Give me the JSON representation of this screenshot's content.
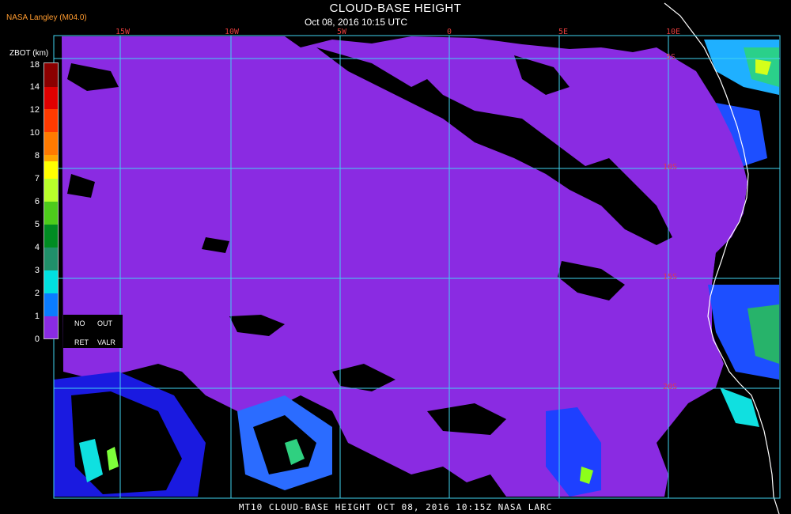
{
  "header": {
    "title": "CLOUD-BASE HEIGHT",
    "subtitle": "Oct 08, 2016 10:15 UTC",
    "producer": "NASA Langley (M04.0)"
  },
  "map": {
    "longitude_labels": [
      "15W",
      "10W",
      "5W",
      "0",
      "5E",
      "10E"
    ],
    "latitude_labels": [
      "5S",
      "10S",
      "15S",
      "20S"
    ],
    "colors": {
      "background_no_retrieval": "#000000",
      "dominant_cloud_base": "#8a2be2",
      "grid": "#41d3f0",
      "coastline": "#ffffff"
    }
  },
  "legend": {
    "title": "ZBOT (km)",
    "ticks": [
      "18",
      "14",
      "12",
      "10",
      "8",
      "7",
      "6",
      "5",
      "4",
      "3",
      "2",
      "1",
      "0"
    ],
    "colors": [
      "#8b0000",
      "#e00000",
      "#ff3a00",
      "#ff7a00",
      "#ffa500",
      "#ffff00",
      "#b8ff2a",
      "#4dcc1b",
      "#008c22",
      "#20906a",
      "#00e0e0",
      "#0a7cff",
      "#0000ff",
      "#8a2be2"
    ],
    "no_ret_label": [
      "NO",
      "RET"
    ],
    "out_valr_label": [
      "OUT",
      "VALR"
    ]
  },
  "footer": {
    "caption": "MT10   CLOUD-BASE HEIGHT   OCT 08, 2016 10:15Z   NASA LARC"
  }
}
